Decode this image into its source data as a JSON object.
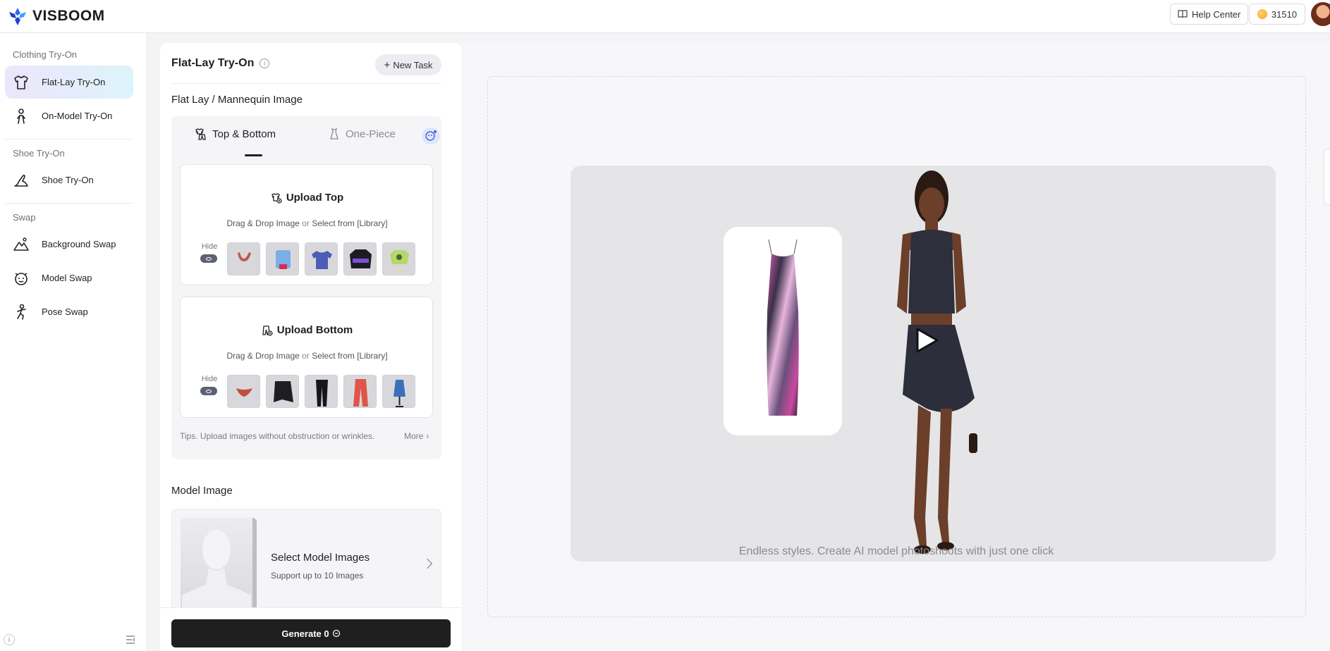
{
  "brand": {
    "name": "VISBOOM"
  },
  "header": {
    "help_label": "Help Center",
    "credits": "31510"
  },
  "sidebar": {
    "sections": [
      {
        "title": "Clothing Try-On"
      },
      {
        "title": "Shoe Try-On"
      },
      {
        "title": "Swap"
      }
    ],
    "items": [
      {
        "label": "Flat-Lay Try-On",
        "icon": "tshirt-icon",
        "active": true
      },
      {
        "label": "On-Model Try-On",
        "icon": "model-icon"
      },
      {
        "label": "Shoe Try-On",
        "icon": "shoe-icon"
      },
      {
        "label": "Background Swap",
        "icon": "mountain-icon"
      },
      {
        "label": "Model Swap",
        "icon": "face-icon"
      },
      {
        "label": "Pose Swap",
        "icon": "pose-icon"
      }
    ]
  },
  "panel": {
    "title": "Flat-Lay Try-On",
    "new_task_label": "New Task",
    "flatlay_title": "Flat Lay / Mannequin Image",
    "tabs": [
      {
        "label": "Top & Bottom",
        "active": true
      },
      {
        "label": "One-Piece",
        "active": false
      }
    ],
    "upload_top": {
      "title": "Upload Top",
      "drag_text": "Drag & Drop Image",
      "or_text": "or",
      "library_text": "Select from [Library]",
      "hide_label": "Hide"
    },
    "upload_bottom": {
      "title": "Upload Bottom",
      "drag_text": "Drag & Drop Image",
      "or_text": "or",
      "library_text": "Select from [Library]",
      "hide_label": "Hide"
    },
    "tips": "Tips. Upload images without obstruction or wrinkles.",
    "more_label": "More",
    "model_section_title": "Model Image",
    "model_select_title": "Select Model Images",
    "model_select_sub": "Support up to 10 Images",
    "generate_label": "Generate 0"
  },
  "preview": {
    "caption": "Endless styles. Create AI model photoshoots with just one click"
  },
  "colors": {
    "accent_dark": "#1f1f1f",
    "active_gradient_start": "#ece6fb",
    "active_gradient_end": "#dcf4fb"
  }
}
